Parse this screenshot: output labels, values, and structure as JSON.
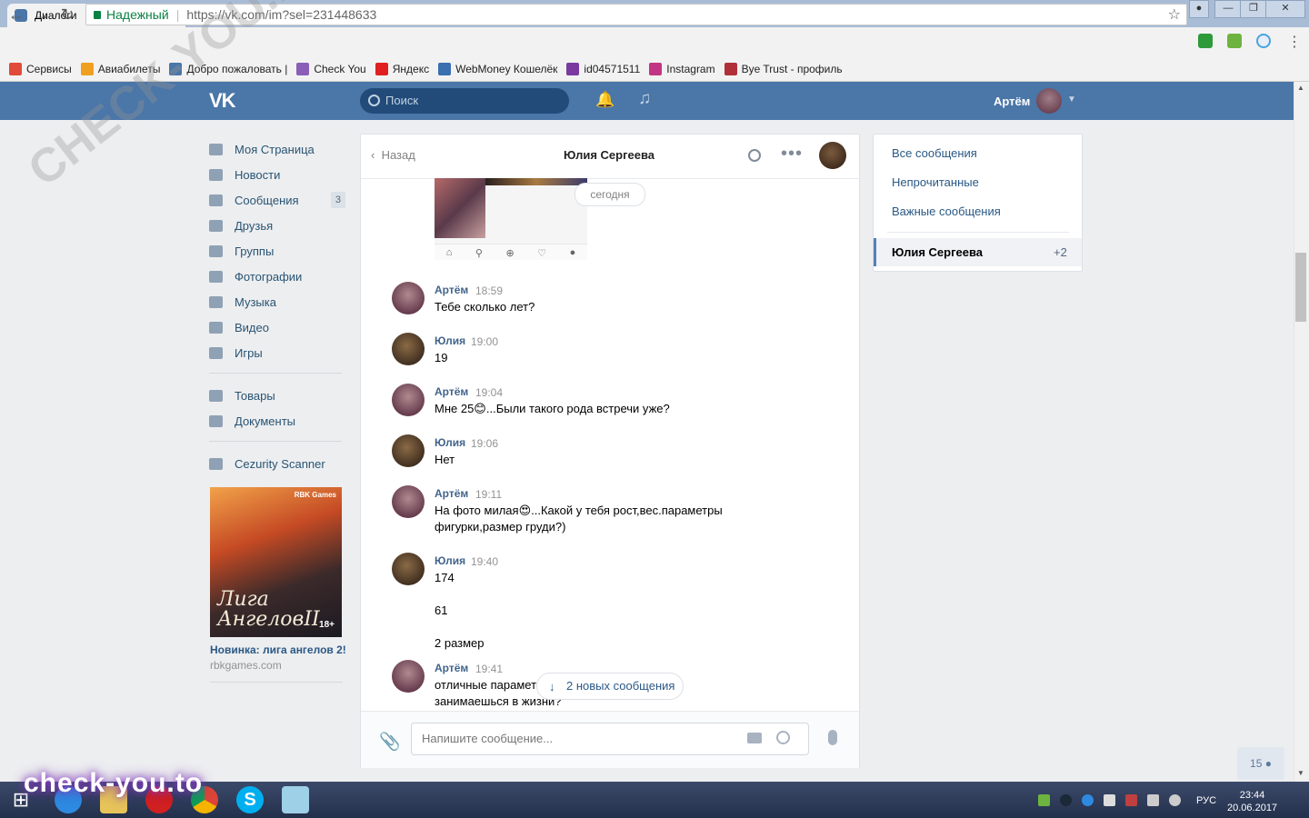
{
  "browser": {
    "tab_title": "Диалоги",
    "tab_close": "×",
    "secure_label": "Надежный",
    "url": "https://vk.com/im?sel=231448633",
    "bookmarks": [
      {
        "label": "Сервисы",
        "color": "#e04b3a"
      },
      {
        "label": "Авиабилеты",
        "color": "#f0a020"
      },
      {
        "label": "Добро пожаловать |",
        "color": "#4a76a8"
      },
      {
        "label": "Check You",
        "color": "#8a5fb8"
      },
      {
        "label": "Яндекс",
        "color": "#e02020"
      },
      {
        "label": "WebMoney Кошелёк",
        "color": "#3a6fb0"
      },
      {
        "label": "id04571511",
        "color": "#7a3aa0"
      },
      {
        "label": "Instagram",
        "color": "#c13584"
      },
      {
        "label": "Bye Trust - профиль",
        "color": "#b0303a"
      }
    ]
  },
  "vk_header": {
    "logo": "VK",
    "search_placeholder": "Поиск",
    "user_name": "Артём"
  },
  "left_menu": {
    "items": [
      {
        "label": "Моя Страница",
        "icon": "home-icon"
      },
      {
        "label": "Новости",
        "icon": "news-icon"
      },
      {
        "label": "Сообщения",
        "icon": "messages-icon",
        "count": "3"
      },
      {
        "label": "Друзья",
        "icon": "friends-icon"
      },
      {
        "label": "Группы",
        "icon": "groups-icon"
      },
      {
        "label": "Фотографии",
        "icon": "photo-icon"
      },
      {
        "label": "Музыка",
        "icon": "music-icon"
      },
      {
        "label": "Видео",
        "icon": "video-icon"
      },
      {
        "label": "Игры",
        "icon": "games-icon"
      }
    ],
    "items2": [
      {
        "label": "Товары",
        "icon": "bag-icon"
      },
      {
        "label": "Документы",
        "icon": "document-icon"
      }
    ],
    "items3": [
      {
        "label": "Cezurity Scanner",
        "icon": "apps-icon"
      }
    ],
    "ad": {
      "image_title_line1": "Лига",
      "image_title_line2": "Ангелов",
      "numeral": "II",
      "badge": "RBK Games",
      "age": "18+",
      "caption": "Новинка: лига ангелов 2!",
      "site": "rbkgames.com"
    }
  },
  "chat": {
    "back_label": "Назад",
    "title": "Юлия Сергеева",
    "date_pill": "сегодня",
    "messages": [
      {
        "author": "Артём",
        "time": "18:59",
        "text": "Тебе сколько лет?",
        "who": "artem"
      },
      {
        "author": "Юлия",
        "time": "19:00",
        "text": "19",
        "who": "yulia"
      },
      {
        "author": "Артём",
        "time": "19:04",
        "text": "Мне 25😊...Были такого рода встречи уже?",
        "who": "artem"
      },
      {
        "author": "Юлия",
        "time": "19:06",
        "text": "Нет",
        "who": "yulia"
      },
      {
        "author": "Артём",
        "time": "19:11",
        "text": "На фото милая😍...Какой у тебя рост,вес.параметры фигурки,размер груди?)",
        "who": "artem"
      },
      {
        "author": "Юлия",
        "time": "19:40",
        "text": "174\n\n61\n\n2 размер",
        "who": "yulia"
      },
      {
        "author": "Артём",
        "time": "19:41",
        "text": "отличные парамет                              м вообще\nзанимаешься в жизни?",
        "who": "artem"
      }
    ],
    "new_messages_pill": "2 новых сообщения",
    "composer_placeholder": "Напишите сообщение..."
  },
  "right_panel": {
    "filters": [
      "Все сообщения",
      "Непрочитанные",
      "Важные сообщения"
    ],
    "active_dialog": "Юлия Сергеева",
    "active_dialog_extra": "+2"
  },
  "online_badge": "15",
  "watermarks": {
    "diagonal": "CHECK-YOU.ME",
    "bottom": "check-you.to"
  },
  "taskbar": {
    "lang": "РУС",
    "time": "23:44",
    "date": "20.06.2017"
  }
}
